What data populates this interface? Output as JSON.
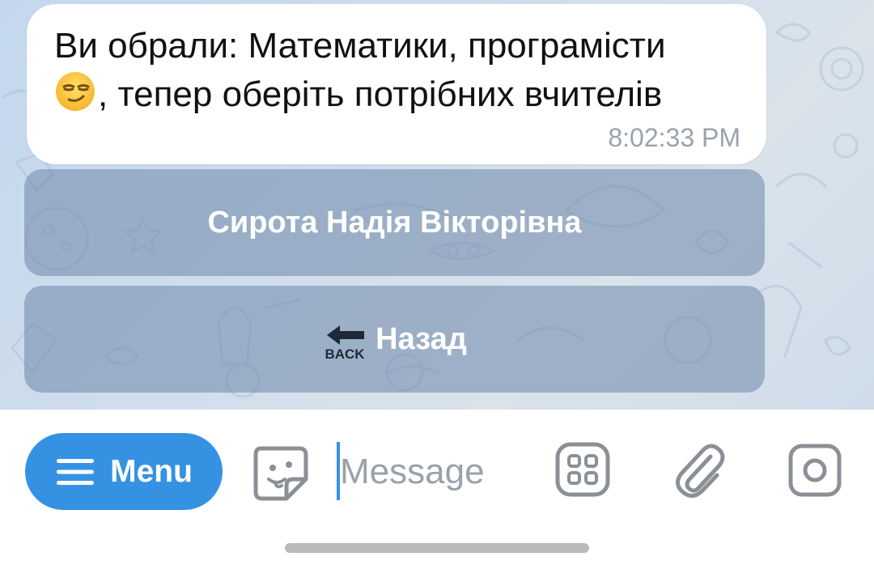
{
  "message": {
    "text_line1": "Ви обрали: Математики, програмісти",
    "text_line2": ", тепер оберіть потрібних вчителів",
    "emoji": "smirking-face",
    "time": "8:02:33 PM"
  },
  "inline_keyboard": {
    "teacher_button": "Сирота Надія Вікторівна",
    "back_button": "Назад",
    "back_icon_text": "BACK"
  },
  "input_bar": {
    "menu_label": "Menu",
    "message_placeholder": "Message",
    "icons": [
      "menu-lines-icon",
      "sticker-icon",
      "apps-icon",
      "attach-icon",
      "camera-icon"
    ]
  },
  "colors": {
    "accent": "#3592e3",
    "inline_button": "#8fa6c4",
    "bubble": "#ffffff",
    "time_text": "#9aa3ad"
  }
}
